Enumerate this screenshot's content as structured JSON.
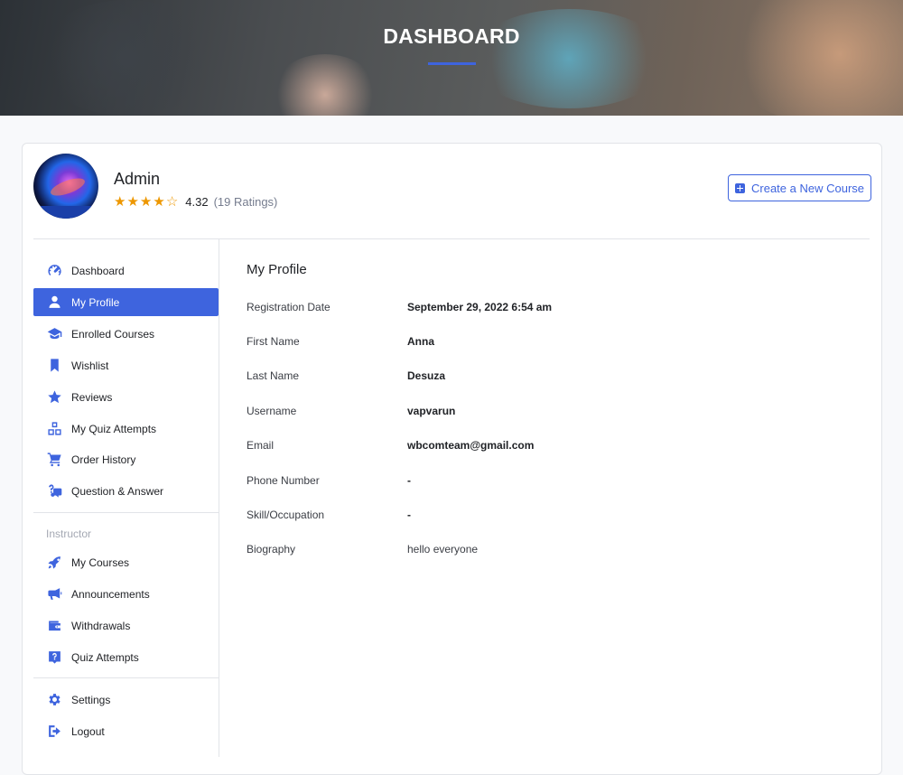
{
  "header": {
    "title": "DASHBOARD",
    "accent": "#3e64de"
  },
  "user": {
    "name": "Admin",
    "rating_value": "4.32",
    "rating_count": "(19 Ratings)",
    "stars": 4.32
  },
  "actions": {
    "create_course_label": "Create a New Course"
  },
  "nav": {
    "main": [
      {
        "label": "Dashboard",
        "icon": "dashboard-icon"
      },
      {
        "label": "My Profile",
        "icon": "user-icon",
        "active": true
      },
      {
        "label": "Enrolled Courses",
        "icon": "graduation-cap-icon"
      },
      {
        "label": "Wishlist",
        "icon": "bookmark-icon"
      },
      {
        "label": "Reviews",
        "icon": "star-icon"
      },
      {
        "label": "My Quiz Attempts",
        "icon": "quiz-icon"
      },
      {
        "label": "Order History",
        "icon": "cart-icon"
      },
      {
        "label": "Question & Answer",
        "icon": "question-answer-icon"
      }
    ],
    "instructor_heading": "Instructor",
    "instructor": [
      {
        "label": "My Courses",
        "icon": "rocket-icon"
      },
      {
        "label": "Announcements",
        "icon": "megaphone-icon"
      },
      {
        "label": "Withdrawals",
        "icon": "wallet-icon"
      },
      {
        "label": "Quiz Attempts",
        "icon": "question-box-icon"
      }
    ],
    "bottom": [
      {
        "label": "Settings",
        "icon": "gear-icon"
      },
      {
        "label": "Logout",
        "icon": "logout-icon"
      }
    ]
  },
  "profile": {
    "title": "My Profile",
    "rows": [
      {
        "label": "Registration Date",
        "value": "September 29, 2022 6:54 am"
      },
      {
        "label": "First Name",
        "value": "Anna"
      },
      {
        "label": "Last Name",
        "value": "Desuza"
      },
      {
        "label": "Username",
        "value": "vapvarun"
      },
      {
        "label": "Email",
        "value": "wbcomteam@gmail.com"
      },
      {
        "label": "Phone Number",
        "value": "-"
      },
      {
        "label": "Skill/Occupation",
        "value": "-"
      },
      {
        "label": "Biography",
        "value": "hello everyone"
      }
    ]
  }
}
